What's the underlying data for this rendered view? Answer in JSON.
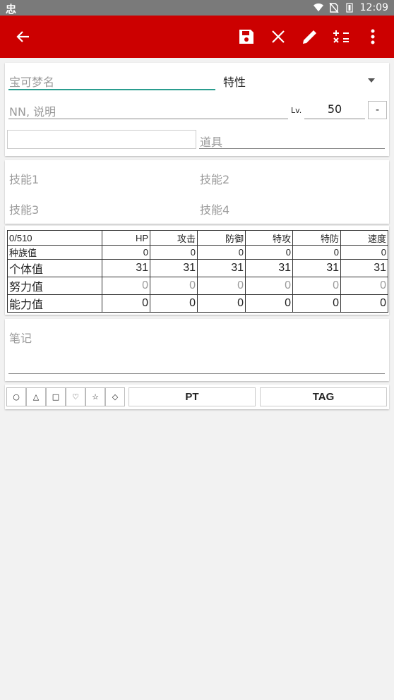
{
  "status_bar": {
    "time": "12:09",
    "app_glyph": "忠"
  },
  "toolbar": {
    "back_icon": "arrow-left-icon",
    "save_icon": "save-icon",
    "close_icon": "close-icon",
    "edit_icon": "pencil-icon",
    "calc_icon": "calculator-icon",
    "more_icon": "more-vert-icon",
    "background": "#cc0000"
  },
  "form": {
    "pokemon_name_placeholder": "宝可梦名",
    "ability_label": "特性",
    "nickname_placeholder": "NN, 说明",
    "lv_label": "Lv.",
    "level_value": "50",
    "minus_button": "-",
    "item_placeholder": "道具",
    "accent": "#2a9d8f"
  },
  "moves": [
    "技能1",
    "技能2",
    "技能3",
    "技能4"
  ],
  "stats": {
    "ev_total": "0/510",
    "columns": [
      "HP",
      "攻击",
      "防御",
      "特攻",
      "特防",
      "速度"
    ],
    "rows": [
      {
        "label": "种族值",
        "values": [
          "0",
          "0",
          "0",
          "0",
          "0",
          "0"
        ]
      },
      {
        "label": "个体值",
        "values": [
          "31",
          "31",
          "31",
          "31",
          "31",
          "31"
        ]
      },
      {
        "label": "努力值",
        "values": [
          "0",
          "0",
          "0",
          "0",
          "0",
          "0"
        ]
      },
      {
        "label": "能力值",
        "values": [
          "0",
          "0",
          "0",
          "0",
          "0",
          "0"
        ]
      }
    ]
  },
  "notes": {
    "placeholder": "笔记"
  },
  "bottom": {
    "marks": [
      "○",
      "△",
      "□",
      "♡",
      "☆",
      "◇"
    ],
    "pt_button": "PT",
    "tag_button": "TAG"
  }
}
